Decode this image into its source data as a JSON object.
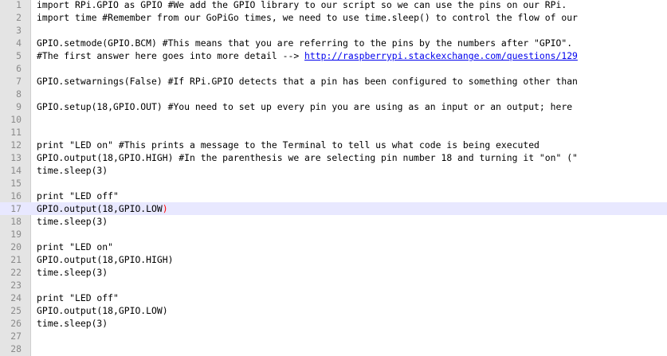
{
  "editor": {
    "lines": [
      {
        "number": "1",
        "text": "import RPi.GPIO as GPIO #We add the GPIO library to our script so we can use the pins on our RPi."
      },
      {
        "number": "2",
        "text": "import time #Remember from our GoPiGo times, we need to use time.sleep() to control the flow of our"
      },
      {
        "number": "3",
        "text": ""
      },
      {
        "number": "4",
        "text": "GPIO.setmode(GPIO.BCM) #This means that you are referring to the pins by the numbers after \"GPIO\"."
      },
      {
        "number": "5",
        "text": "#The first answer here goes into more detail --> ",
        "link": "http://raspberrypi.stackexchange.com/questions/129"
      },
      {
        "number": "6",
        "text": ""
      },
      {
        "number": "7",
        "text": "GPIO.setwarnings(False) #If RPi.GPIO detects that a pin has been configured to something other than"
      },
      {
        "number": "8",
        "text": ""
      },
      {
        "number": "9",
        "text": "GPIO.setup(18,GPIO.OUT) #You need to set up every pin you are using as an input or an output; here"
      },
      {
        "number": "10",
        "text": ""
      },
      {
        "number": "11",
        "text": ""
      },
      {
        "number": "12",
        "text": "print \"LED on\" #This prints a message to the Terminal to tell us what code is being executed"
      },
      {
        "number": "13",
        "text": "GPIO.output(18,GPIO.HIGH) #In the parenthesis we are selecting pin number 18 and turning it \"on\" (\""
      },
      {
        "number": "14",
        "text": "time.sleep(3)"
      },
      {
        "number": "15",
        "text": ""
      },
      {
        "number": "16",
        "text": "print \"LED off\""
      },
      {
        "number": "17",
        "text": "GPIO.output(18,GPIO.LOW",
        "suffix": ")",
        "current": true
      },
      {
        "number": "18",
        "text": "time.sleep(3)"
      },
      {
        "number": "19",
        "text": ""
      },
      {
        "number": "20",
        "text": "print \"LED on\""
      },
      {
        "number": "21",
        "text": "GPIO.output(18,GPIO.HIGH)"
      },
      {
        "number": "22",
        "text": "time.sleep(3)"
      },
      {
        "number": "23",
        "text": ""
      },
      {
        "number": "24",
        "text": "print \"LED off\""
      },
      {
        "number": "25",
        "text": "GPIO.output(18,GPIO.LOW)"
      },
      {
        "number": "26",
        "text": "time.sleep(3)"
      },
      {
        "number": "27",
        "text": ""
      },
      {
        "number": "28",
        "text": ""
      }
    ]
  },
  "colors": {
    "gutter_bg": "#e4e4e4",
    "line_number": "#8a8a8a",
    "current_line_bg": "#e8e8ff",
    "link": "#0000ee",
    "bracket_match": "#ff0000"
  }
}
